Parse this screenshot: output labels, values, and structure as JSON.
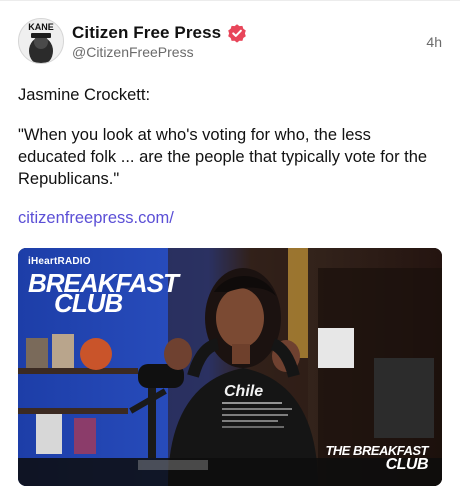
{
  "post": {
    "author": {
      "display_name": "Citizen Free Press",
      "handle": "@CitizenFreePress",
      "avatar_text": "KANE",
      "verified": true,
      "verified_color": "#e8465a"
    },
    "timestamp": "4h",
    "body": {
      "line1": "Jasmine Crockett:",
      "quote": "\"When you look at who's voting for who, the less educated folk ... are the people that typically vote for the Republicans.\"",
      "link": "citizenfreepress.com/"
    },
    "media": {
      "brand_small": "iHeartRADIO",
      "brand_title_1": "BREAKFAST",
      "brand_title_2": "CLUB",
      "watermark_1": "THE BREAKFAST",
      "watermark_2": "CLUB",
      "hoodie_text": "Chile"
    },
    "colors": {
      "link": "#5b4fd6",
      "accent": "#e8465a",
      "muted": "#6b6b6b"
    }
  }
}
